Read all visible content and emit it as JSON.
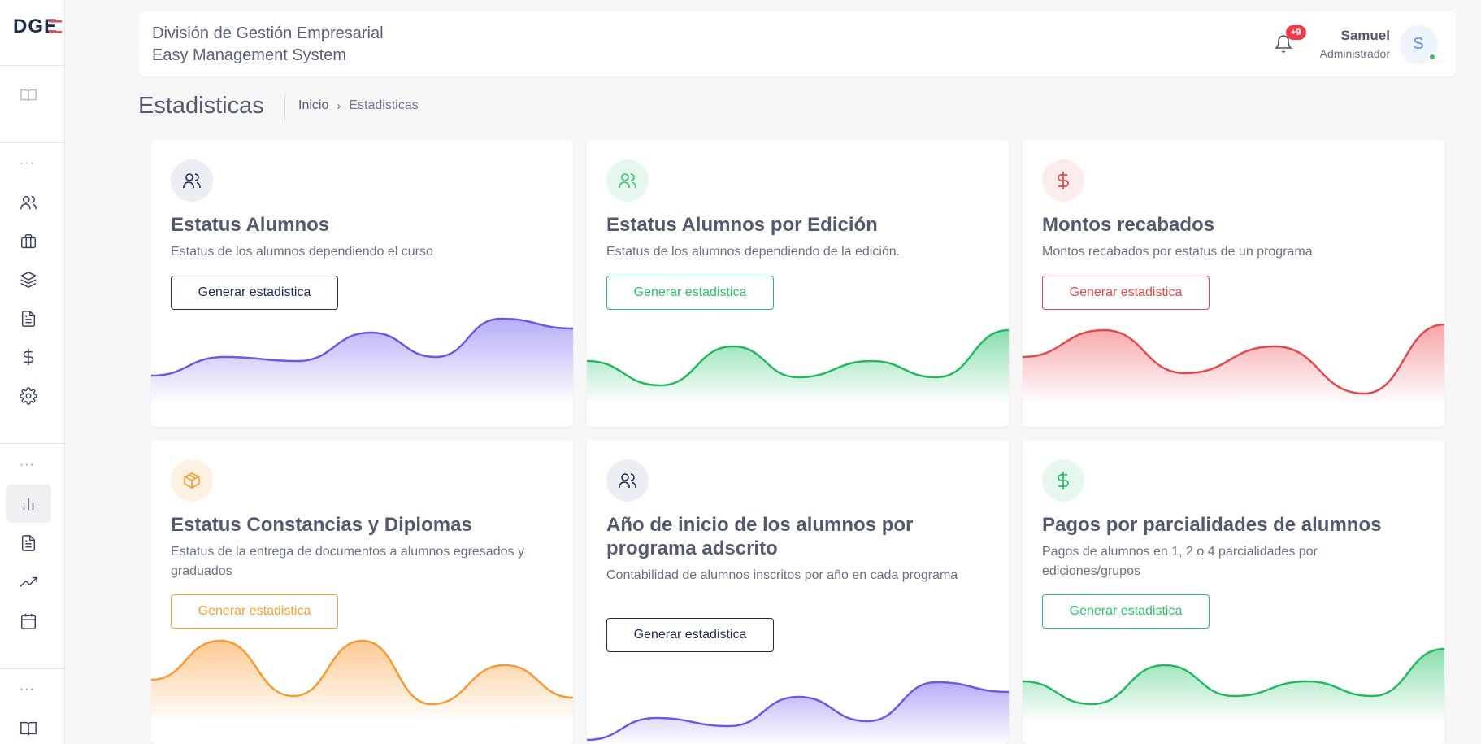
{
  "header": {
    "org_name": "División de Gestión Empresarial",
    "system_name": "Easy Management System",
    "notification_badge": "+9",
    "user": {
      "name": "Samuel",
      "role": "Administrador",
      "initial": "S"
    }
  },
  "page": {
    "title": "Estadisticas",
    "breadcrumb": [
      "Inicio",
      "Estadisticas"
    ]
  },
  "sidebar": {
    "logo": "DGE",
    "items": [
      {
        "icon": "book-open-icon"
      },
      {
        "icon": "users-icon"
      },
      {
        "icon": "briefcase-icon"
      },
      {
        "icon": "layers-icon"
      },
      {
        "icon": "file-text-icon"
      },
      {
        "icon": "dollar-icon"
      },
      {
        "icon": "settings-icon"
      },
      {
        "icon": "bar-chart-icon",
        "active": true
      },
      {
        "icon": "file-text-icon"
      },
      {
        "icon": "trending-up-icon"
      },
      {
        "icon": "calendar-icon"
      },
      {
        "icon": "book-icon"
      }
    ]
  },
  "cards": [
    {
      "title": "Estatus Alumnos",
      "description": "Estatus de los alumnos dependiendo el curso",
      "button": "Generar estadistica",
      "icon": "users-icon",
      "color": "#1f2a55",
      "fill": "#7b6cf0",
      "stroke": "#6a5ae6"
    },
    {
      "title": "Estatus Alumnos por Edición",
      "description": "Estatus de los alumnos dependiendo de la edición.",
      "button": "Generar estadistica",
      "icon": "users-icon",
      "color": "#29c36a",
      "fill": "#29c36a",
      "stroke": "#24b961"
    },
    {
      "title": "Montos recabados",
      "description": "Montos recabados por estatus de un programa",
      "button": "Generar estadistica",
      "icon": "dollar-icon",
      "color": "#e5484d",
      "fill": "#ef5a5f",
      "stroke": "#e34a4f"
    },
    {
      "title": "Estatus Constancias y Diplomas",
      "description": "Estatus de la entrega de documentos a alumnos egresados y graduados",
      "button": "Generar estadistica",
      "icon": "box-icon",
      "color": "#f99d2f",
      "fill": "#fb9d3a",
      "stroke": "#f89a33"
    },
    {
      "title": "Año de inicio de los alumnos por programa adscrito",
      "description": "Contabilidad de alumnos inscritos por año en cada programa",
      "button": "Generar estadistica",
      "icon": "users-icon",
      "color": "#1f2a55",
      "fill": "#7b6cf0",
      "stroke": "#6a5ae6"
    },
    {
      "title": "Pagos por parcialidades de alumnos",
      "description": "Pagos de alumnos en 1, 2 o 4 parcialidades por ediciones/grupos",
      "button": "Generar estadistica",
      "icon": "dollar-icon",
      "color": "#29c36a",
      "fill": "#29c36a",
      "stroke": "#24b961"
    }
  ]
}
